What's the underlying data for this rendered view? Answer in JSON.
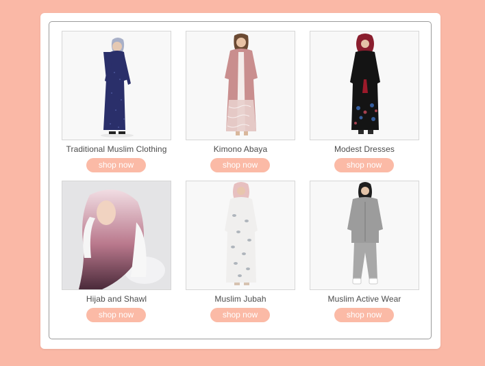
{
  "theme": {
    "background": "#fab8a6",
    "button_color": "#fbbaa6",
    "button_text_color": "#ffffff"
  },
  "categories": [
    {
      "title": "Traditional Muslim Clothing",
      "button": "shop now",
      "image": "navy-sequin-dress-photo"
    },
    {
      "title": "Kimono Abaya",
      "button": "shop now",
      "image": "pink-lace-abaya-photo"
    },
    {
      "title": "Modest Dresses",
      "button": "shop now",
      "image": "black-floral-dress-photo"
    },
    {
      "title": "Hijab and Shawl",
      "button": "shop now",
      "image": "ombre-hijab-photo"
    },
    {
      "title": "Muslim Jubah",
      "button": "shop now",
      "image": "white-sequin-jubah-photo"
    },
    {
      "title": "Muslim Active Wear",
      "button": "shop now",
      "image": "grey-tracksuit-photo"
    }
  ]
}
